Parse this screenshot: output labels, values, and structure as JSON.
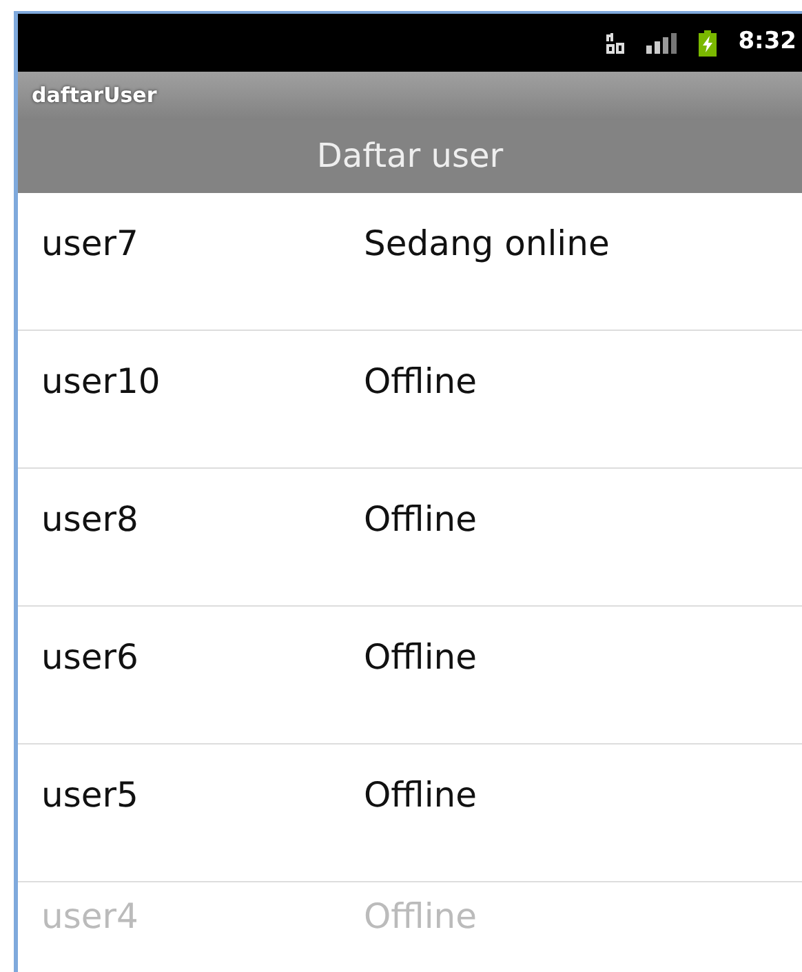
{
  "status_bar": {
    "time": "8:32"
  },
  "app_title": "daftarUser",
  "header": "Daftar user",
  "users": [
    {
      "name": "user7",
      "status": "Sedang online"
    },
    {
      "name": "user10",
      "status": "Offline"
    },
    {
      "name": "user8",
      "status": "Offline"
    },
    {
      "name": "user6",
      "status": "Offline"
    },
    {
      "name": "user5",
      "status": "Offline"
    },
    {
      "name": "user4",
      "status": "Offline"
    }
  ]
}
